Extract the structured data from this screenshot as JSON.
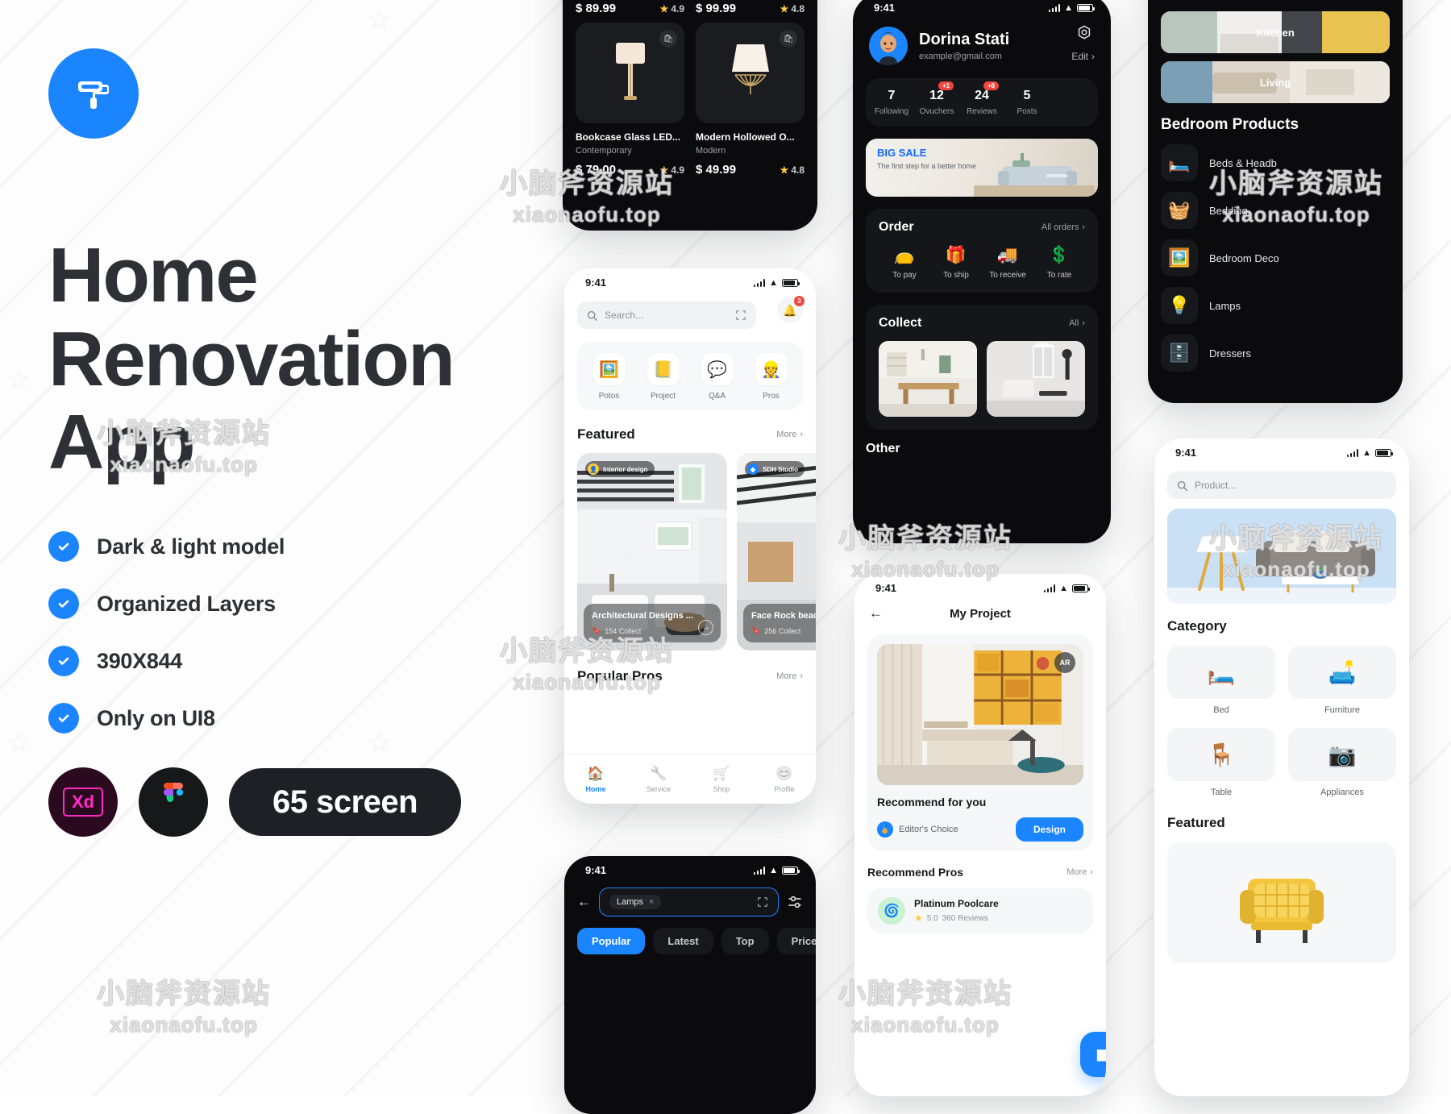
{
  "hero": {
    "logo_icon": "paint-roller-icon",
    "title_lines": [
      "Home",
      "Renovation",
      "App"
    ],
    "features": [
      "Dark & light model",
      "Organized Layers",
      "390X844",
      "Only on UI8"
    ],
    "badges": {
      "xd_label": "Xd",
      "figma_icon": "figma-icon",
      "screens_pill": "65 screen"
    },
    "accent_color": "#1A85FF",
    "text_color": "#2d3135"
  },
  "watermark": {
    "cn": "小脑斧资源站",
    "en": "xiaonaofu.top"
  },
  "product_screen": {
    "items": [
      {
        "price": "$ 89.99",
        "rating": "4.9",
        "name": "Bookcase Glass LED...",
        "category": "Contemporary",
        "icon": "table-lamp-icon",
        "bag_icon": "shopping-bag-icon"
      },
      {
        "price": "$ 99.99",
        "rating": "4.8",
        "name": "Modern Hollowed O...",
        "category": "Modern",
        "icon": "pendant-lamp-icon",
        "bag_icon": "shopping-bag-icon"
      },
      {
        "price": "$ 79.00",
        "rating": "4.9",
        "name": "",
        "category": "",
        "icon": "",
        "bag_icon": ""
      },
      {
        "price": "$ 49.99",
        "rating": "4.8",
        "name": "",
        "category": "",
        "icon": "",
        "bag_icon": ""
      }
    ]
  },
  "profile_screen": {
    "status_time": "9:41",
    "gear_icon": "gear-icon",
    "name": "Dorina Stati",
    "email": "example@gmail.com",
    "edit_label": "Edit",
    "stats": [
      {
        "number": "7",
        "label": "Following",
        "badge": ""
      },
      {
        "number": "12",
        "label": "Ovuchers",
        "badge": "+1"
      },
      {
        "number": "24",
        "label": "Reviews",
        "badge": "+8"
      },
      {
        "number": "5",
        "label": "Posts",
        "badge": ""
      }
    ],
    "banner": {
      "title": "BIG SALE",
      "subtitle": "The first step for a better home"
    },
    "order": {
      "title": "Order",
      "link": "All orders",
      "items": [
        {
          "label": "To pay",
          "icon": "wallet-icon"
        },
        {
          "label": "To ship",
          "icon": "package-icon"
        },
        {
          "label": "To receive",
          "icon": "truck-icon"
        },
        {
          "label": "To rate",
          "icon": "coin-icon"
        }
      ]
    },
    "collect": {
      "title": "Collect",
      "link": "All"
    },
    "other_title": "Other"
  },
  "home_screen": {
    "status_time": "9:41",
    "search_placeholder": "Search...",
    "scan_icon": "scan-icon",
    "bell_icon": "bell-icon",
    "bell_count": "3",
    "quick_actions": [
      {
        "label": "Potos",
        "icon": "photo-icon"
      },
      {
        "label": "Project",
        "icon": "folder-icon"
      },
      {
        "label": "Q&A",
        "icon": "question-bubble-icon"
      },
      {
        "label": "Pros",
        "icon": "professional-icon"
      }
    ],
    "featured": {
      "title": "Featured",
      "more": "More",
      "cards": [
        {
          "tag": "Interior design",
          "name": "Architectural Designs ...",
          "collect": "154 Collect"
        },
        {
          "tag": "SDH Studio",
          "name": "Face Rock beac",
          "collect": "256 Collect"
        }
      ]
    },
    "popular_pros": {
      "title": "Popular Pros",
      "more": "More"
    },
    "tabs": [
      {
        "label": "Home",
        "icon": "home-icon",
        "active": true
      },
      {
        "label": "Service",
        "icon": "service-icon",
        "active": false
      },
      {
        "label": "Shop",
        "icon": "cart-icon",
        "active": false
      },
      {
        "label": "Profile",
        "icon": "profile-icon",
        "active": false
      }
    ]
  },
  "project_screen": {
    "status_time": "9:41",
    "back_icon": "arrow-left-icon",
    "title": "My Project",
    "ar_label": "AR",
    "recommend_title": "Recommend for you",
    "editors_choice": "Editor's Choice",
    "design_button": "Design",
    "pros_title": "Recommend Pros",
    "pros_more": "More",
    "pro": {
      "name": "Platinum Poolcare",
      "rating": "5.0",
      "reviews": "360 Reviews"
    },
    "fab_icon": "cube-icon"
  },
  "category_screen": {
    "rooms": [
      {
        "label": "Kitchen"
      },
      {
        "label": "Living"
      }
    ],
    "section_title": "Bedroom Products",
    "items": [
      {
        "label": "Beds & Headb",
        "icon": "bed-icon"
      },
      {
        "label": "Bedding",
        "icon": "bedding-icon"
      },
      {
        "label": "Bedroom Deco",
        "icon": "frame-icon"
      },
      {
        "label": "Lamps",
        "icon": "lamp-icon"
      },
      {
        "label": "Dressers",
        "icon": "dresser-icon"
      }
    ]
  },
  "shop_screen": {
    "status_time": "9:41",
    "search_placeholder": "Product...",
    "category_title": "Category",
    "categories": [
      {
        "label": "Bed",
        "icon": "bed-icon"
      },
      {
        "label": "Furniture",
        "icon": "sofa-icon"
      },
      {
        "label": "Table",
        "icon": "table-icon"
      },
      {
        "label": "Appliances",
        "icon": "appliance-icon"
      }
    ],
    "featured_title": "Featured"
  },
  "search_screen": {
    "status_time": "9:41",
    "back_icon": "arrow-left-icon",
    "chip_label": "Lamps",
    "chip_close_icon": "close-icon",
    "scan_icon": "scan-icon",
    "filter_icon": "sliders-icon",
    "filters": [
      {
        "label": "Popular",
        "active": true,
        "caret": false
      },
      {
        "label": "Latest",
        "active": false,
        "caret": false
      },
      {
        "label": "Top",
        "active": false,
        "caret": false
      },
      {
        "label": "Price",
        "active": false,
        "caret": true
      }
    ]
  }
}
